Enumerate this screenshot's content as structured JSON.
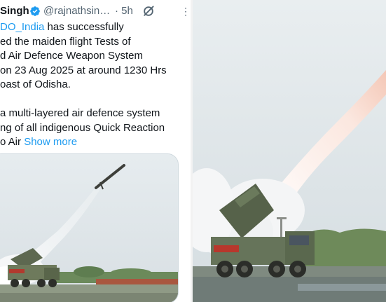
{
  "tweet": {
    "author_name": "Singh",
    "handle": "@rajnathsin…",
    "time": "· 5h",
    "menu_label": "⋮",
    "body": {
      "line1_mention": "DO_India",
      "line1_rest": " has successfully",
      "line2": "ed the maiden flight Tests of",
      "line3": "d Air Defence Weapon System",
      "line4": "on 23 Aug 2025 at around 1230 Hrs",
      "line5": "oast of Odisha.",
      "line6": "a multi-layered air defence system",
      "line7": "ng of all indigenous Quick Reaction",
      "line8_text": "o Air ",
      "show_more": "Show more"
    }
  },
  "colors": {
    "link": "#1d9bf0",
    "text": "#0f1419",
    "secondary": "#536471",
    "verified": "#1d9bf0"
  },
  "icons": {
    "verified": "verified-badge-icon",
    "grok": "grok-icon",
    "more": "more-options-icon"
  },
  "media": {
    "tweet_image": "missile-launch-photo",
    "side_image": "missile-launcher-photo"
  }
}
